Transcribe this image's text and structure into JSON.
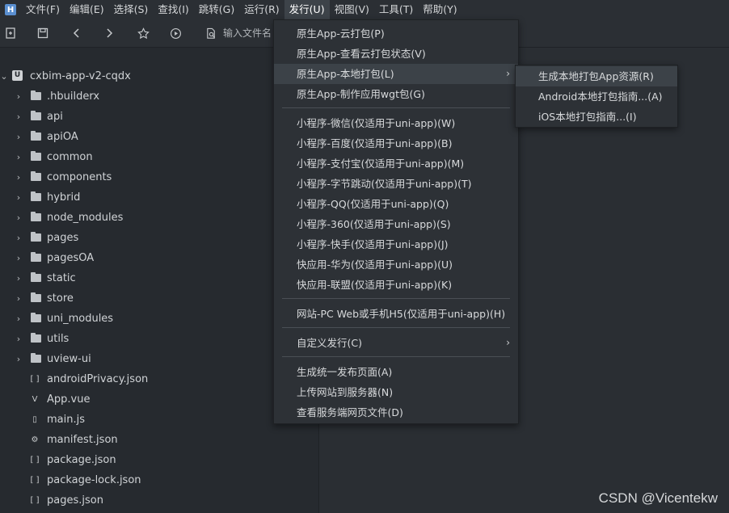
{
  "menubar": {
    "items": [
      {
        "label": "文件(F)"
      },
      {
        "label": "编辑(E)"
      },
      {
        "label": "选择(S)"
      },
      {
        "label": "查找(I)"
      },
      {
        "label": "跳转(G)"
      },
      {
        "label": "运行(R)"
      },
      {
        "label": "发行(U)"
      },
      {
        "label": "视图(V)"
      },
      {
        "label": "工具(T)"
      },
      {
        "label": "帮助(Y)"
      }
    ]
  },
  "toolbar": {
    "search_placeholder": "输入文件名"
  },
  "explorer": {
    "root": "cxbim-app-v2-cqdx",
    "folders": [
      ".hbuilderx",
      "api",
      "apiOA",
      "common",
      "components",
      "hybrid",
      "node_modules",
      "pages",
      "pagesOA",
      "static",
      "store",
      "uni_modules",
      "utils",
      "uview-ui"
    ],
    "files": [
      {
        "name": "androidPrivacy.json",
        "icon": "json-icon"
      },
      {
        "name": "App.vue",
        "icon": "vue-icon"
      },
      {
        "name": "main.js",
        "icon": "js-icon"
      },
      {
        "name": "manifest.json",
        "icon": "manifest-icon"
      },
      {
        "name": "package.json",
        "icon": "json-icon"
      },
      {
        "name": "package-lock.json",
        "icon": "json-icon"
      },
      {
        "name": "pages.json",
        "icon": "json-icon"
      }
    ]
  },
  "publish_menu": {
    "group1": [
      "原生App-云打包(P)",
      "原生App-查看云打包状态(V)",
      "原生App-本地打包(L)",
      "原生App-制作应用wgt包(G)"
    ],
    "group2": [
      "小程序-微信(仅适用于uni-app)(W)",
      "小程序-百度(仅适用于uni-app)(B)",
      "小程序-支付宝(仅适用于uni-app)(M)",
      "小程序-字节跳动(仅适用于uni-app)(T)",
      "小程序-QQ(仅适用于uni-app)(Q)",
      "小程序-360(仅适用于uni-app)(S)",
      "小程序-快手(仅适用于uni-app)(J)",
      "快应用-华为(仅适用于uni-app)(U)",
      "快应用-联盟(仅适用于uni-app)(K)"
    ],
    "group3": [
      "网站-PC Web或手机H5(仅适用于uni-app)(H)"
    ],
    "group4": [
      "自定义发行(C)"
    ],
    "group5": [
      "生成统一发布页面(A)",
      "上传网站到服务器(N)",
      "查看服务端网页文件(D)"
    ]
  },
  "local_pack_submenu": [
    "生成本地打包App资源(R)",
    "Android本地打包指南...(A)",
    "iOS本地打包指南...(I)"
  ],
  "watermark": "CSDN @Vicentekw"
}
